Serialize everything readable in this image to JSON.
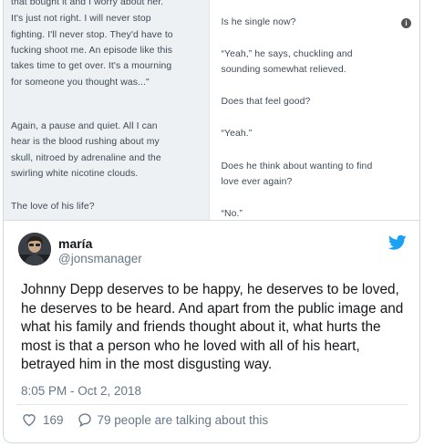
{
  "media": {
    "left_lines": [
      "that bought it and I worry about her.",
      "It's just not right. I will never stop",
      "fighting. I'll never stop. They'd have to",
      "fucking shoot me. An episode like this",
      "takes time to get over. It's a mourning",
      "for someone you thought was...\"",
      "Again, a pause and quiet. All I can",
      "hear is the blood rushing about my",
      "skull, nitroed by adrenaline and the",
      "swirling white nicotine clouds.",
      "The love of his life?"
    ],
    "right_lines": [
      "Is he single now?",
      "“Yeah,” he says, chuckling and",
      "sounding somewhat relieved.",
      "Does that feel good?",
      "“Yeah.”",
      "Does he think about wanting to find",
      "love ever again?",
      "“No.”"
    ],
    "info_glyph": "i"
  },
  "tweet": {
    "display_name": "maría",
    "handle": "@jonsmanager",
    "text": "Johnny Depp deserves to be happy, he deserves to be loved, he deserves to be heard. And apart from the public image and what his family and friends thought about it, what hurts the most is that a person who he loved with all of his heart, betrayed him in the most disgusting way.",
    "timestamp": "8:05 PM - Oct 2, 2018",
    "like_count": "169",
    "talking_text": "79 people are talking about this"
  },
  "colors": {
    "twitter_blue": "#1da1f2",
    "secondary_text": "#657786",
    "primary_text": "#14171a"
  },
  "icons": {
    "brand": "twitter-bird-icon",
    "like": "heart-icon",
    "reply": "speech-bubble-icon",
    "info": "info-icon"
  }
}
